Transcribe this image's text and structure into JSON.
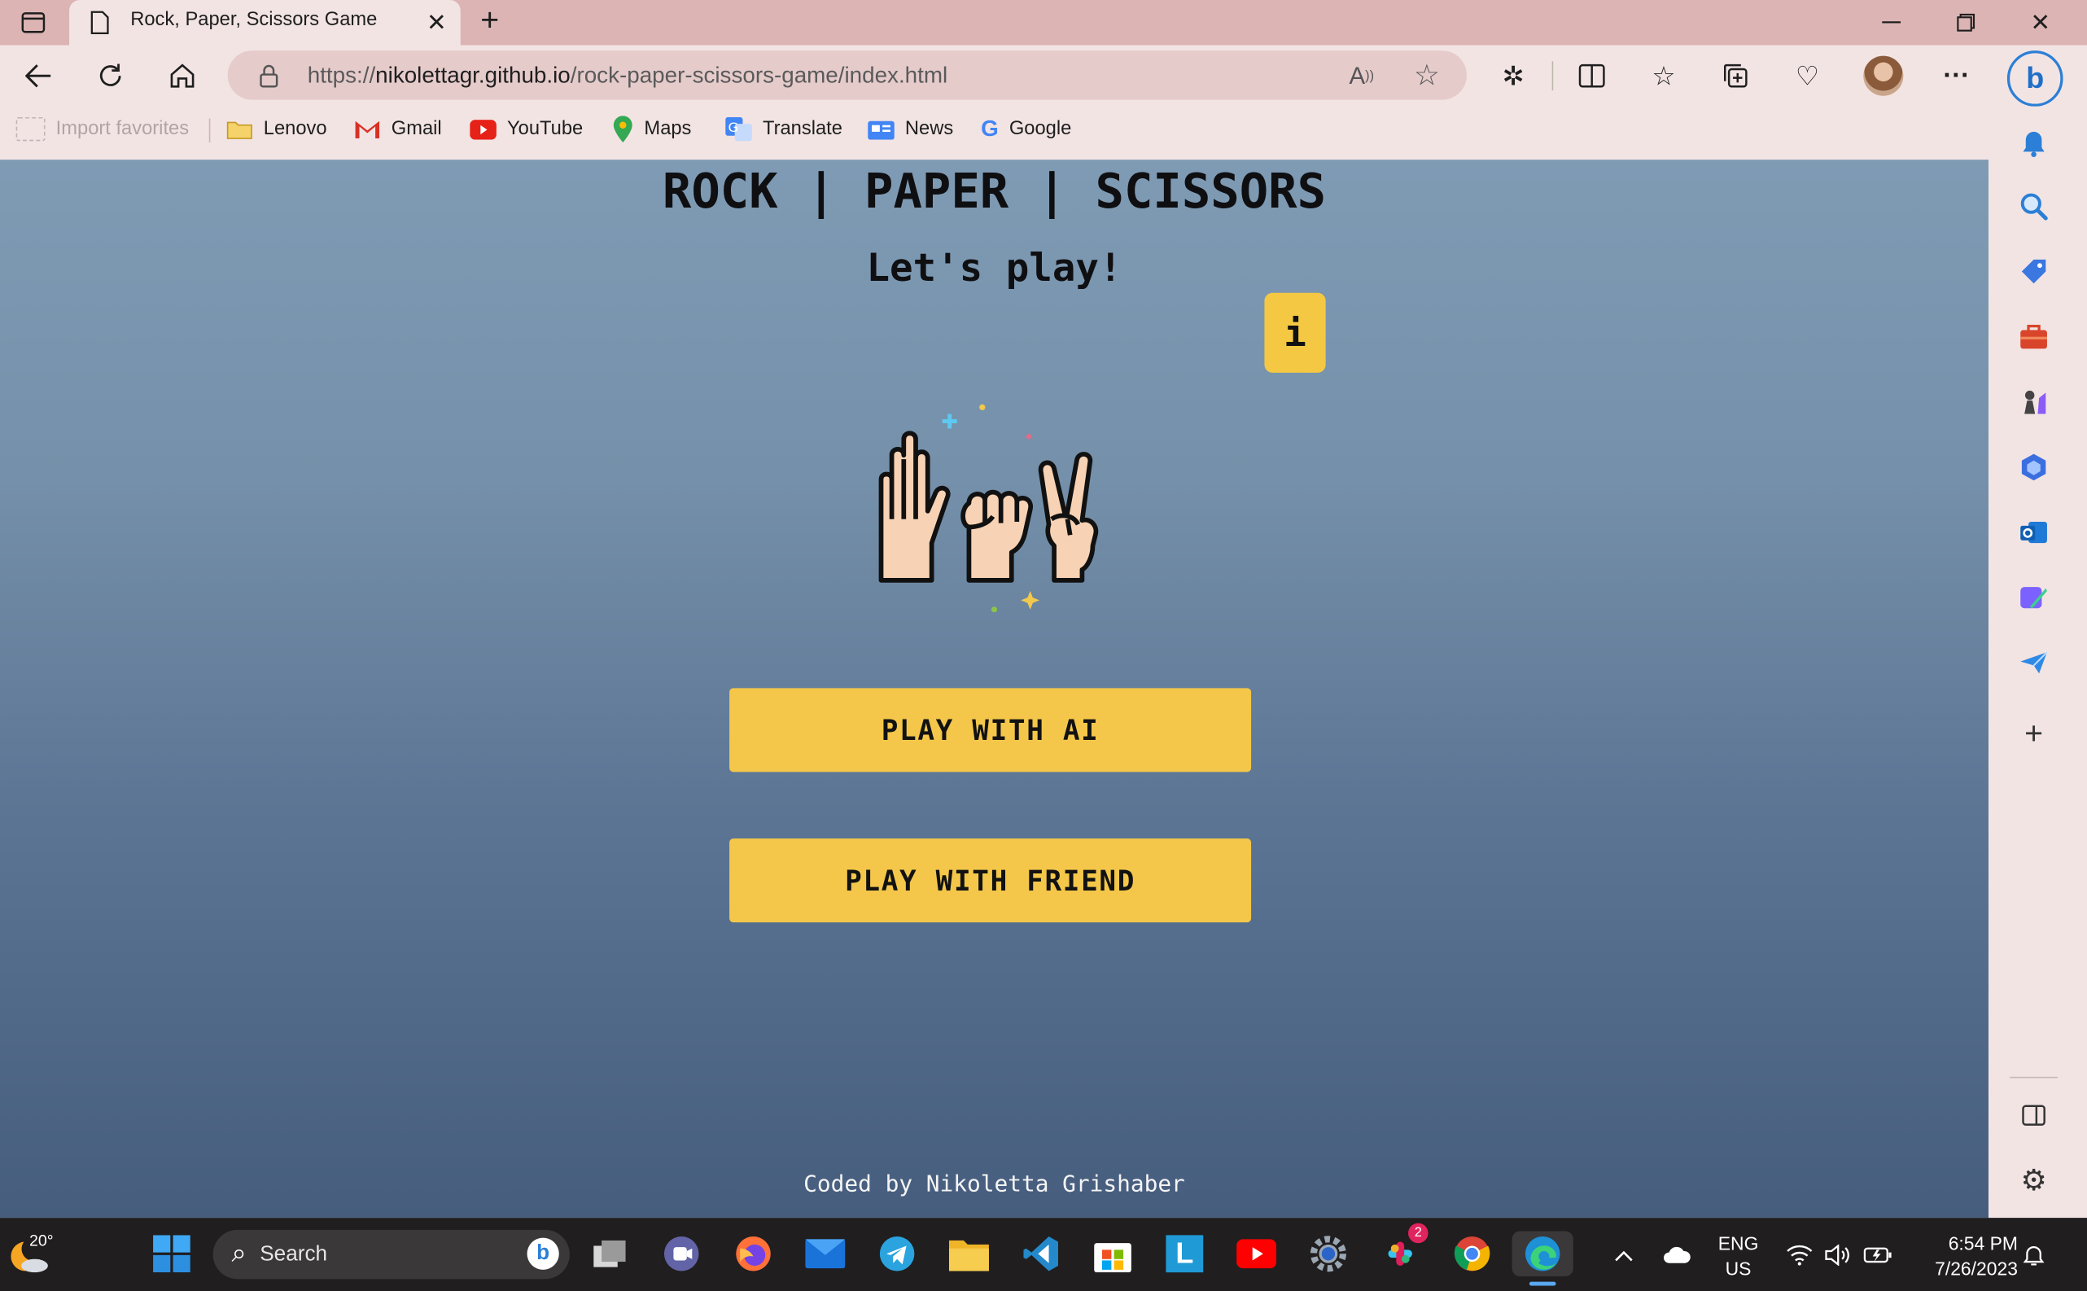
{
  "browser": {
    "tab_title": "Rock, Paper, Scissors Game",
    "url_prefix": "https://",
    "url_domain": "nikolettagr.github.io",
    "url_path": "/rock-paper-scissors-game/index.html"
  },
  "favorites": [
    {
      "label": "Import favorites"
    },
    {
      "label": "Lenovo"
    },
    {
      "label": "Gmail"
    },
    {
      "label": "YouTube"
    },
    {
      "label": "Maps"
    },
    {
      "label": "Translate"
    },
    {
      "label": "News"
    },
    {
      "label": "Google"
    }
  ],
  "page": {
    "title": "ROCK | PAPER | SCISSORS",
    "subtitle": "Let's play!",
    "info_label": "i",
    "play_ai_label": "PLAY WITH AI",
    "play_friend_label": "PLAY WITH FRIEND",
    "footer": "Coded by Nikoletta Grishaber"
  },
  "taskbar": {
    "weather_temp": "20°",
    "search_placeholder": "Search",
    "slack_badge": "2",
    "lang_line1": "ENG",
    "lang_line2": "US",
    "time": "6:54 PM",
    "date": "7/26/2023"
  },
  "colors": {
    "button": "#f4c74a",
    "page_top": "#7f9bb4",
    "page_bottom": "#465d7e",
    "browser_chrome": "#f3e4e4"
  }
}
